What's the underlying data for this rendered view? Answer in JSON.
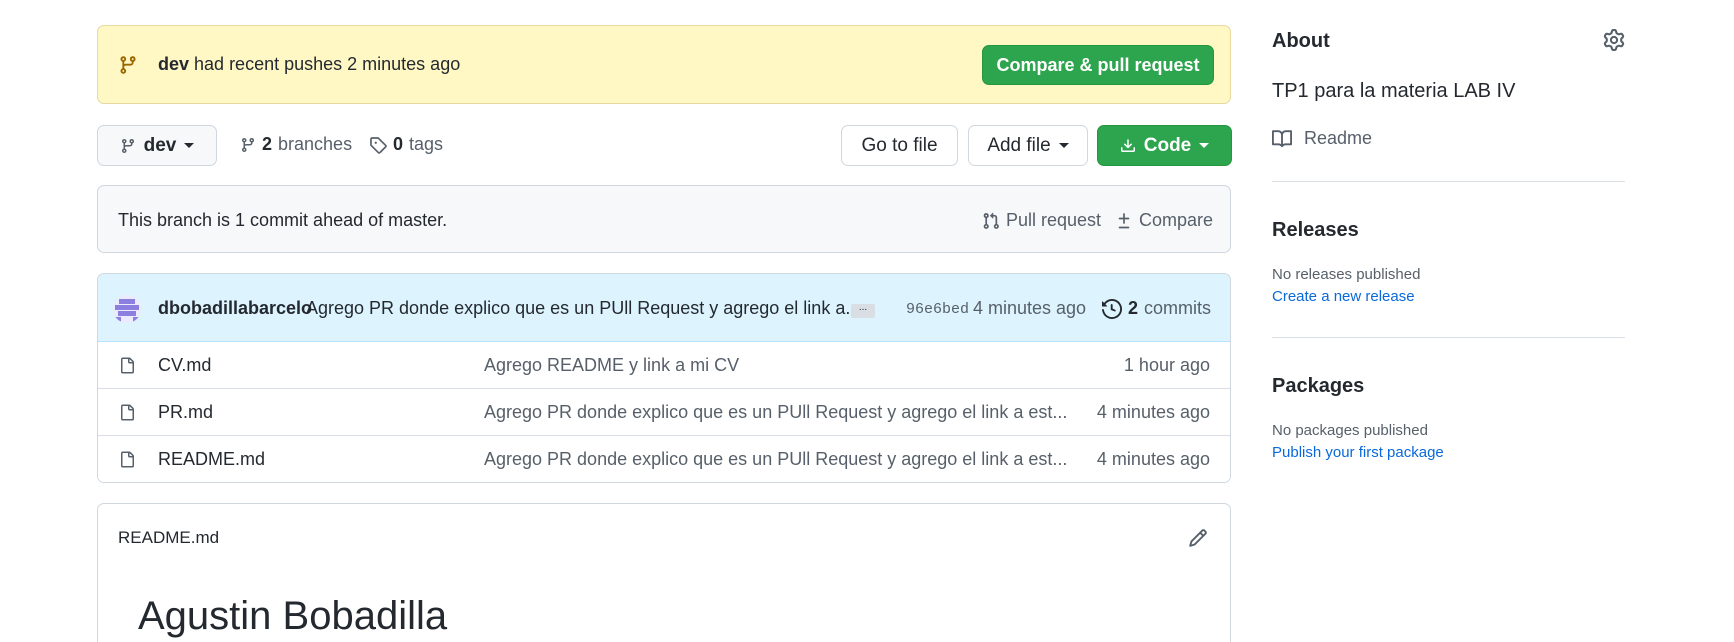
{
  "push_banner": {
    "branch": "dev",
    "message": " had recent pushes 2 minutes ago",
    "button_label": "Compare & pull request"
  },
  "toolbar": {
    "branch_label": "dev",
    "branches_count": "2",
    "branches_label": "branches",
    "tags_count": "0",
    "tags_label": "tags",
    "go_to_file_label": "Go to file",
    "add_file_label": "Add file",
    "code_label": "Code"
  },
  "ahead_bar": {
    "text": "This branch is 1 commit ahead of master.",
    "pull_request_label": "Pull request",
    "compare_label": "Compare"
  },
  "latest_commit": {
    "author": "dbobadillabarcelo",
    "message": "Agrego PR donde explico que es un PUll Request y agrego el link a...",
    "ellipsis": "...",
    "sha": "96e6bed",
    "time": "4 minutes ago",
    "commits_count": "2",
    "commits_label": "commits"
  },
  "files": [
    {
      "name": "CV.md",
      "message": "Agrego README y link a mi CV",
      "age": "1 hour ago"
    },
    {
      "name": "PR.md",
      "message": "Agrego PR donde explico que es un PUll Request y agrego el link a est...",
      "age": "4 minutes ago"
    },
    {
      "name": "README.md",
      "message": "Agrego PR donde explico que es un PUll Request y agrego el link a est...",
      "age": "4 minutes ago"
    }
  ],
  "readme": {
    "title": "README.md",
    "heading": "Agustin Bobadilla"
  },
  "sidebar": {
    "about_title": "About",
    "description": "TP1 para la materia LAB IV",
    "readme_label": "Readme",
    "releases_title": "Releases",
    "releases_empty": "No releases published",
    "releases_link": "Create a new release",
    "packages_title": "Packages",
    "packages_empty": "No packages published",
    "packages_link": "Publish your first package"
  },
  "colors": {
    "accent_green": "#2da44e",
    "banner_yellow": "#fff8c5",
    "link_blue": "#0969da",
    "commit_row_blue": "#ddf4ff"
  },
  "icons": [
    "git-branch-icon",
    "tag-icon",
    "download-icon",
    "pull-request-icon",
    "diff-icon",
    "history-icon",
    "file-icon",
    "pencil-icon",
    "gear-icon",
    "book-icon"
  ]
}
